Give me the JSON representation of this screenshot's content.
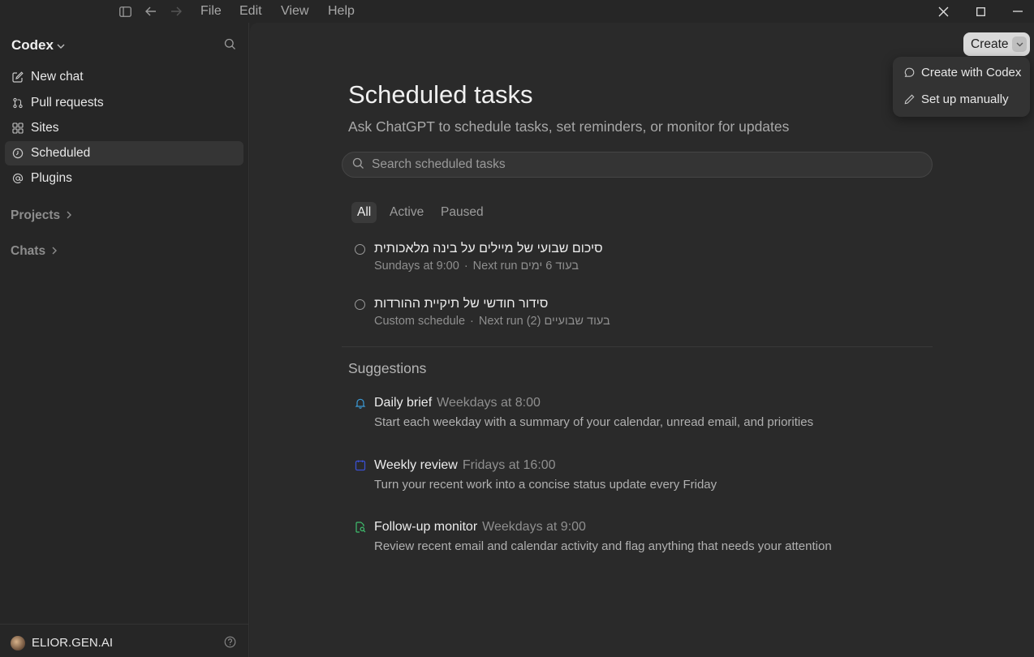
{
  "menubar": {
    "items": [
      "File",
      "Edit",
      "View",
      "Help"
    ]
  },
  "sidebar": {
    "brand": "Codex",
    "nav": [
      {
        "label": "New chat",
        "icon": "edit-icon"
      },
      {
        "label": "Pull requests",
        "icon": "pull-request-icon"
      },
      {
        "label": "Sites",
        "icon": "sites-icon"
      },
      {
        "label": "Scheduled",
        "icon": "clock-icon",
        "active": true
      },
      {
        "label": "Plugins",
        "icon": "at-icon"
      }
    ],
    "sections": [
      "Projects",
      "Chats"
    ],
    "user": "ELIOR.GEN.AI"
  },
  "header": {
    "create_label": "Create",
    "dropdown": [
      {
        "label": "Create with Codex",
        "icon": "chat-bubble-icon"
      },
      {
        "label": "Set up manually",
        "icon": "pencil-icon"
      }
    ]
  },
  "main": {
    "title": "Scheduled tasks",
    "subtitle": "Ask ChatGPT to schedule tasks, set reminders, or monitor for updates",
    "search_placeholder": "Search scheduled tasks",
    "tabs": [
      "All",
      "Active",
      "Paused"
    ],
    "active_tab": "All",
    "tasks": [
      {
        "title": "סיכום שבועי של מיילים על בינה מלאכותית",
        "schedule": "Sundays at 9:00",
        "next_run": "Next run בעוד 6 ימים"
      },
      {
        "title": "סידור חודשי של תיקיית ההורדות",
        "schedule": "Custom schedule",
        "next_run": "Next run (2) בעוד שבועיים"
      }
    ],
    "suggestions_title": "Suggestions",
    "suggestions": [
      {
        "title": "Daily brief",
        "when": "Weekdays at 8:00",
        "desc": "Start each weekday with a summary of your calendar, unread email, and priorities",
        "icon": "bell-icon",
        "color": "#3b9bd8"
      },
      {
        "title": "Weekly review",
        "when": "Fridays at 16:00",
        "desc": "Turn your recent work into a concise status update every Friday",
        "icon": "calendar-icon",
        "color": "#3a4fd0"
      },
      {
        "title": "Follow-up monitor",
        "when": "Weekdays at 9:00",
        "desc": "Review recent email and calendar activity and flag anything that needs your attention",
        "icon": "doc-search-icon",
        "color": "#3fbf6e"
      }
    ]
  }
}
